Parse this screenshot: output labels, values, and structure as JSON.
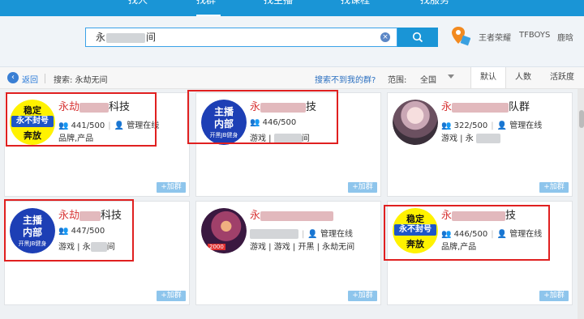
{
  "nav": {
    "tabs": [
      "找人",
      "找群",
      "找主播",
      "找课程",
      "找服务"
    ]
  },
  "search": {
    "value_prefix": "永",
    "value_suffix": "间",
    "clear": "×"
  },
  "hot_words": [
    "王者荣耀",
    "TFBOYS",
    "鹿晗"
  ],
  "subbar": {
    "back": "返回",
    "search_label": "搜索: 永劫无间",
    "not_found": "搜索不到我的群?",
    "range_label": "范围:",
    "range_value": "全国",
    "sort_tabs": [
      "默认",
      "人数",
      "活跃度"
    ]
  },
  "cards": [
    {
      "badge": "yellow",
      "badge_lines": [
        "稳定",
        "永不封号",
        "奔放"
      ],
      "name_red": "永劫",
      "name_tail": "科技",
      "members": "441/500",
      "manager": "管理在线",
      "tags": "品牌,产品",
      "join": "+加群"
    },
    {
      "badge": "blue",
      "badge_lines": [
        "主播",
        "内部",
        "开黑JB健身"
      ],
      "name_red": "永",
      "name_tail": "技",
      "members": "446/500",
      "manager": "",
      "tags": "游戏 |",
      "tags_tail": "间",
      "join": "+加群"
    },
    {
      "badge": "photo",
      "name_red": "永",
      "name_tail": "队群",
      "members": "322/500",
      "manager": "管理在线",
      "tags": "游戏 | 永",
      "join": "+加群"
    },
    {
      "badge": "blue",
      "badge_lines": [
        "主播",
        "内部",
        "开黑JB健身"
      ],
      "name_red": "永劫",
      "name_tail": "科技",
      "members": "447/500",
      "manager": "",
      "tags": "游戏 | 永",
      "tags_tail": "间",
      "join": "+加群"
    },
    {
      "badge": "game",
      "badge_level": "2000",
      "name_red": "永",
      "name_tail": "",
      "members": "",
      "manager": "管理在线",
      "tags": "游戏 | 游戏 | 开黑 | 永劫无间",
      "join": "+加群"
    },
    {
      "badge": "yellow",
      "badge_lines": [
        "稳定",
        "永不封号",
        "奔放"
      ],
      "name_red": "永",
      "name_tail": "技",
      "members": "446/500",
      "manager": "管理在线",
      "tags": "品牌,产品",
      "join": "+加群"
    }
  ],
  "colors": {
    "brand": "#1a95d6",
    "highlight": "#e02020",
    "name_red": "#d83a3a"
  }
}
